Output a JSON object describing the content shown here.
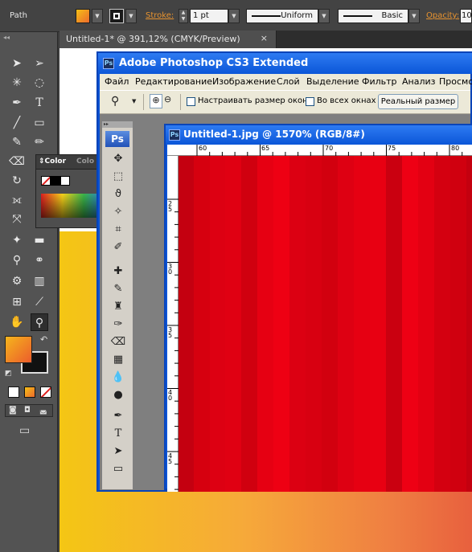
{
  "illustrator": {
    "control_bar": {
      "selection_type": "Path",
      "stroke_label": "Stroke:",
      "stroke_weight": "1 pt",
      "profile": "Uniform",
      "brush": "Basic",
      "opacity_label": "Opacity:",
      "opacity_value": "10"
    },
    "document_tab": "Untitled-1* @ 391,12% (CMYK/Preview)",
    "color_panel": {
      "tab_color": "Color",
      "tab_color_guide": "Colo"
    },
    "colors": {
      "fill_gradient_start": "#f0a22c",
      "fill_gradient_end": "#e8603e",
      "canvas_left": "#f4c614",
      "canvas_right": "#e8603e"
    }
  },
  "photoshop": {
    "app_title": "Adobe Photoshop CS3 Extended",
    "menu": [
      "Файл",
      "Редактирование",
      "Изображение",
      "Слой",
      "Выделение",
      "Фильтр",
      "Анализ",
      "Просмотр"
    ],
    "options": {
      "resize_windows": "Настраивать размер окон",
      "all_windows": "Во всех окнах",
      "actual_pixels": "Реальный размер"
    },
    "tools_logo": "Ps",
    "document": {
      "title": "Untitled-1.jpg @ 1570% (RGB/8#)",
      "ruler_top": [
        "60",
        "65",
        "70",
        "75",
        "80"
      ],
      "ruler_left": [
        "25",
        "30",
        "35",
        "40",
        "45"
      ]
    },
    "colors": {
      "title_bar": "#0b56d8",
      "canvas_red": "#e60012",
      "stripe_dark": "#c40010"
    }
  }
}
